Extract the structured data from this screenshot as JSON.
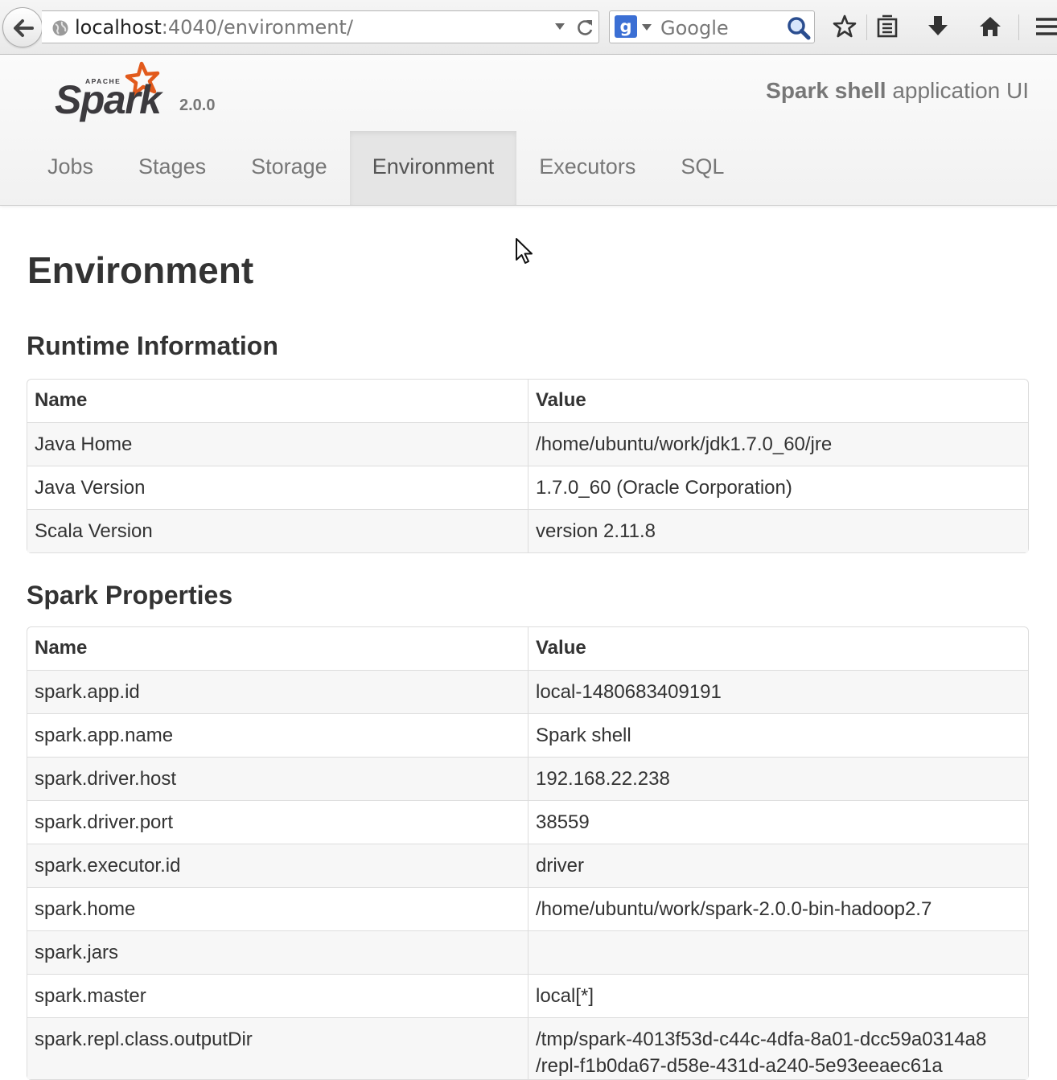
{
  "browser": {
    "url_host": "localhost",
    "url_rest": ":4040/environment/",
    "search_engine_glyph": "g",
    "search_placeholder": "Google",
    "icons": [
      "back-arrow-icon",
      "globe-icon",
      "chevron-down-icon",
      "reload-icon",
      "search-icon",
      "star-icon",
      "bookmarks-icon",
      "download-icon",
      "home-icon",
      "menu-icon"
    ]
  },
  "header": {
    "logo_alt": "Apache Spark",
    "version": "2.0.0",
    "app_title_bold": "Spark shell",
    "app_title_rest": " application UI"
  },
  "nav": {
    "items": [
      {
        "label": "Jobs"
      },
      {
        "label": "Stages"
      },
      {
        "label": "Storage"
      },
      {
        "label": "Environment",
        "active": true
      },
      {
        "label": "Executors"
      },
      {
        "label": "SQL"
      }
    ]
  },
  "page": {
    "title": "Environment"
  },
  "runtime": {
    "title": "Runtime Information",
    "columns": [
      "Name",
      "Value"
    ],
    "rows": [
      [
        "Java Home",
        "/home/ubuntu/work/jdk1.7.0_60/jre"
      ],
      [
        "Java Version",
        "1.7.0_60 (Oracle Corporation)"
      ],
      [
        "Scala Version",
        "version 2.11.8"
      ]
    ]
  },
  "spark_props": {
    "title": "Spark Properties",
    "columns": [
      "Name",
      "Value"
    ],
    "rows": [
      [
        "spark.app.id",
        "local-1480683409191"
      ],
      [
        "spark.app.name",
        "Spark shell"
      ],
      [
        "spark.driver.host",
        "192.168.22.238"
      ],
      [
        "spark.driver.port",
        "38559"
      ],
      [
        "spark.executor.id",
        "driver"
      ],
      [
        "spark.home",
        "/home/ubuntu/work/spark-2.0.0-bin-hadoop2.7"
      ],
      [
        "spark.jars",
        ""
      ],
      [
        "spark.master",
        "local[*]"
      ],
      [
        "spark.repl.class.outputDir",
        "/tmp/spark-4013f53d-c44c-4dfa-8a01-dcc59a0314a8\n/repl-f1b0da67-d58e-431d-a240-5e93eeaec61a"
      ]
    ]
  }
}
